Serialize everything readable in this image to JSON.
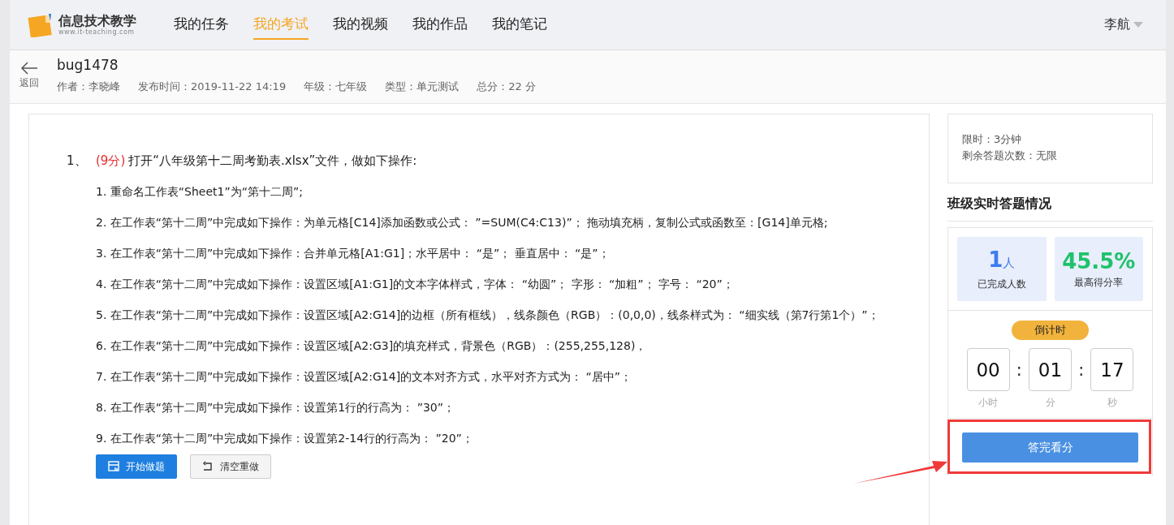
{
  "header": {
    "logo": {
      "title": "信息技术教学",
      "subtitle": "www.it-teaching.com"
    },
    "nav": [
      {
        "label": "我的任务",
        "selected": false
      },
      {
        "label": "我的考试",
        "selected": true
      },
      {
        "label": "我的视频",
        "selected": false
      },
      {
        "label": "我的作品",
        "selected": false
      },
      {
        "label": "我的笔记",
        "selected": false
      }
    ],
    "user": "李航"
  },
  "exam": {
    "back": "返回",
    "title": "bug1478",
    "meta": [
      "作者：李晓峰",
      "发布时间：2019-11-22 14:19",
      "年级：七年级",
      "类型：单元测试",
      "总分：22 分"
    ]
  },
  "question": {
    "number": "1、",
    "score": "(9分)",
    "prompt": "打开“八年级第十二周考勤表.xlsx”文件，做如下操作:",
    "steps": [
      "1. 重命名工作表“Sheet1”为“第十二周”;",
      "2. 在工作表“第十二周”中完成如下操作：为单元格[C14]添加函数或公式： ”=SUM(C4:C13)”； 拖动填充柄，复制公式或函数至：[G14]单元格;",
      "3. 在工作表“第十二周”中完成如下操作：合并单元格[A1:G1]；水平居中： “是”； 垂直居中： “是”；",
      "4. 在工作表“第十二周”中完成如下操作：设置区域[A1:G1]的文本字体样式，字体： “幼圆”； 字形： “加粗”； 字号： “20”；",
      "5. 在工作表“第十二周”中完成如下操作：设置区域[A2:G14]的边框（所有框线），线条颜色（RGB）：(0,0,0)，线条样式为： “细实线（第7行第1个）”；",
      "6. 在工作表“第十二周”中完成如下操作：设置区域[A2:G3]的填充样式，背景色（RGB）：(255,255,128)，",
      "7. 在工作表“第十二周”中完成如下操作：设置区域[A2:G14]的文本对齐方式，水平对齐方式为： “居中”；",
      "8. 在工作表“第十二周”中完成如下操作：设置第1行的行高为： ”30”；",
      "9. 在工作表“第十二周”中完成如下操作：设置第2-14行的行高为： ”20”；"
    ],
    "buttons": [
      {
        "label": "开始做题",
        "kind": "primary"
      },
      {
        "label": "清空重做",
        "kind": "reset"
      }
    ]
  },
  "sidebar": {
    "info": [
      "限时：3分钟",
      "剩余答题次数：无限"
    ],
    "section_title": "班级实时答题情况",
    "stats": [
      {
        "value": "1",
        "unit": "人",
        "label": "已完成人数",
        "color": "#3d7bf0"
      },
      {
        "value": "45.5%",
        "label": "最高得分率",
        "color": "#1fc26b"
      }
    ],
    "countdown": {
      "badge": "倒计时",
      "separator": ":",
      "units": [
        {
          "value": "00",
          "label": "小时"
        },
        {
          "value": "01",
          "label": "分"
        },
        {
          "value": "17",
          "label": "秒"
        }
      ]
    },
    "submit": "答完看分"
  }
}
